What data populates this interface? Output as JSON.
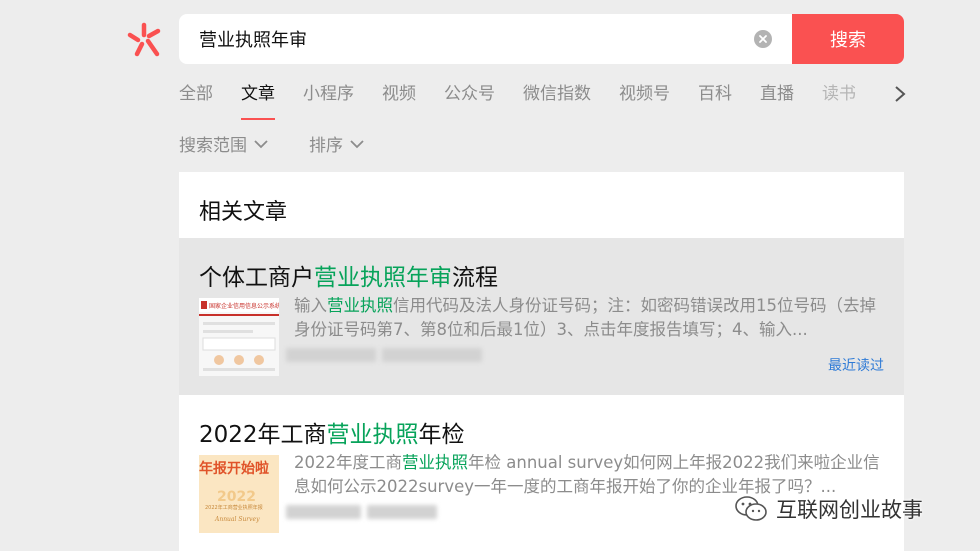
{
  "search": {
    "query": "营业执照年审",
    "button_label": "搜索"
  },
  "tabs": [
    {
      "label": "全部"
    },
    {
      "label": "文章"
    },
    {
      "label": "小程序"
    },
    {
      "label": "视频"
    },
    {
      "label": "公众号"
    },
    {
      "label": "微信指数"
    },
    {
      "label": "视频号"
    },
    {
      "label": "百科"
    },
    {
      "label": "直播"
    },
    {
      "label": "读书"
    }
  ],
  "filters": {
    "range_label": "搜索范围",
    "sort_label": "排序"
  },
  "section": {
    "title": "相关文章"
  },
  "articles": [
    {
      "title_pre": "个体工商户",
      "title_hl": "营业执照年审",
      "title_post": "流程",
      "snippet_pre": "输入",
      "snippet_hl": "营业执照",
      "snippet_post": "信用代码及法人身份证号码；注：如密码错误改用15位号码（去掉身份证号码第7、第8位和后最1位）3、点击年度报告填写；4、输入...",
      "badge": "最近读过",
      "thumb_caption": "国家企业信用信息公示系统"
    },
    {
      "title_pre": "2022年工商",
      "title_hl": "营业执照",
      "title_post": "年检",
      "snippet_pre": "2022年度工商",
      "snippet_hl": "营业执照",
      "snippet_post": "年检 annual survey如何网上年报2022我们来啦企业信息如何公示2022survey一年一度的工商年报开始了你的企业年报了吗？...",
      "thumb_caption": "年报开始啦",
      "thumb_sub": "2022",
      "thumb_sub2": "2022年工商营业执照年报",
      "thumb_sub3": "Annual Survey"
    }
  ],
  "watermark": {
    "text": "互联网创业故事"
  },
  "colors": {
    "accent": "#fa5151",
    "highlight": "#07a35a",
    "link": "#2f7bd6"
  }
}
